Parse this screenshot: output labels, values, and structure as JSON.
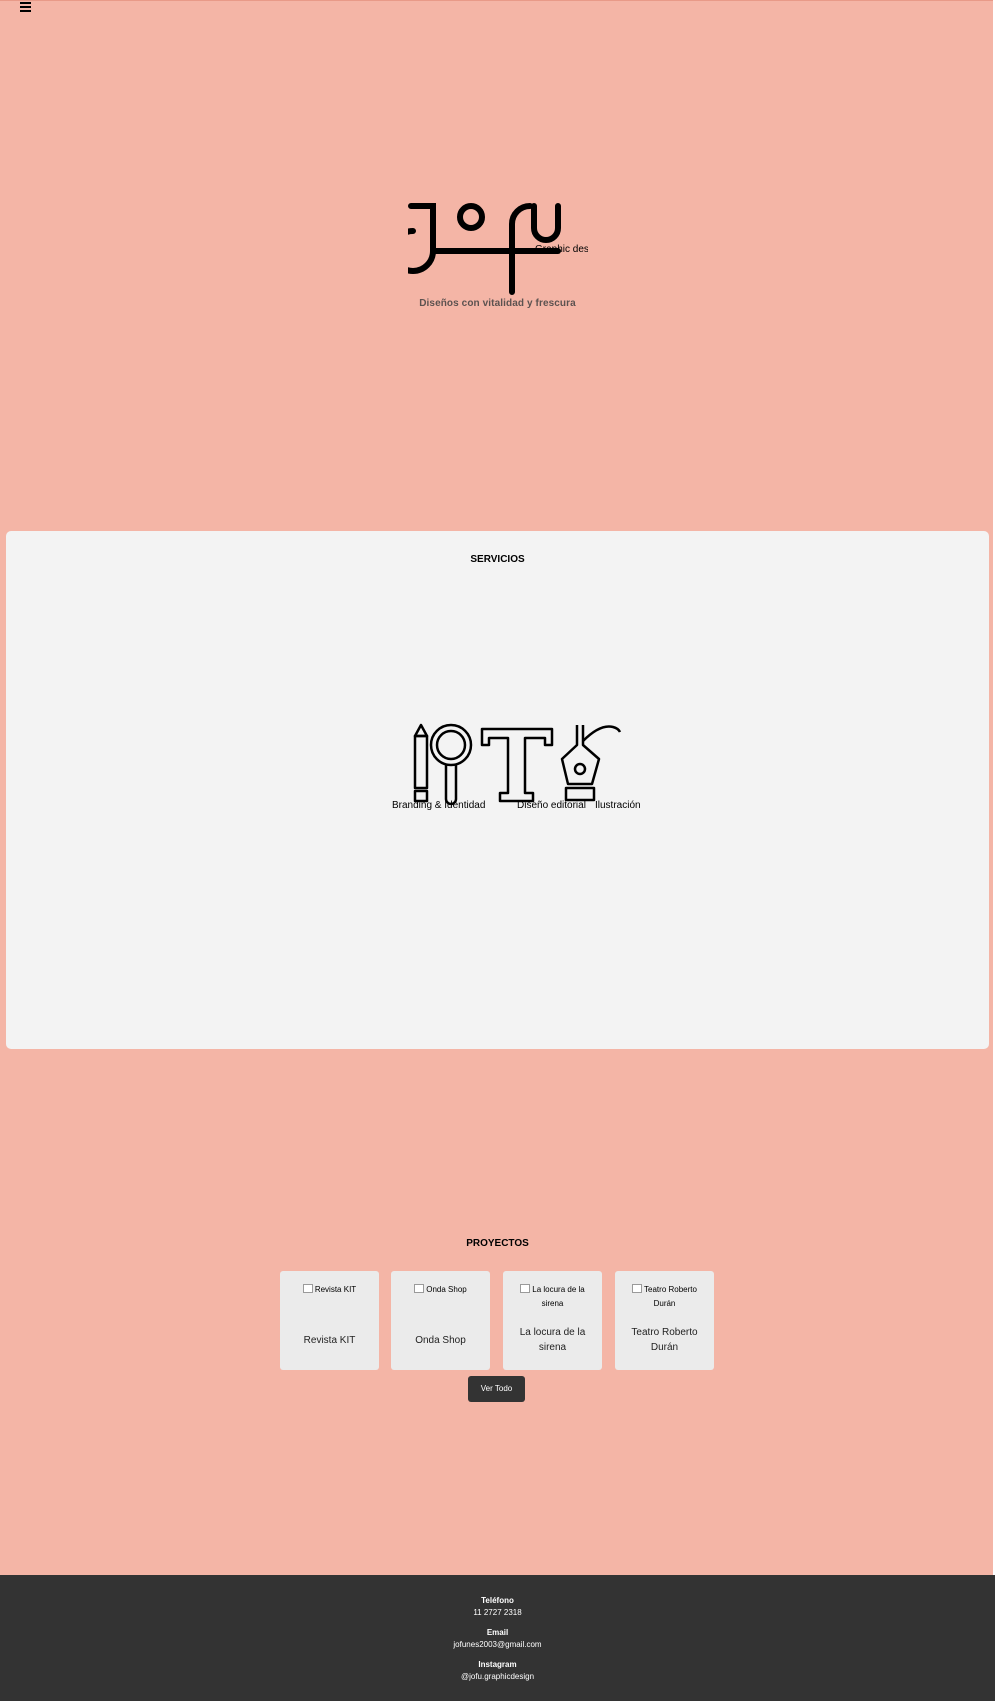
{
  "nav": {
    "menu_icon": "hamburger-menu-icon"
  },
  "hero": {
    "logo_wordmark": "jofu",
    "logo_subtitle": "Graphic design",
    "tagline": "Diseños con vitalidad y frescura"
  },
  "services": {
    "title": "SERVICIOS",
    "items": [
      {
        "label": "Branding & Identidad",
        "icon": "pencil-magnifier-icon"
      },
      {
        "label": "Diseño editorial",
        "icon": "letter-t-icon"
      },
      {
        "label": "Ilustración",
        "icon": "pen-nib-icon"
      }
    ]
  },
  "projects": {
    "title": "PROYECTOS",
    "items": [
      {
        "image_alt": "Revista KIT",
        "name": "Revista KIT"
      },
      {
        "image_alt": "Onda Shop",
        "name": "Onda Shop"
      },
      {
        "image_alt": "La locura de la sirena",
        "name": "La locura de la sirena"
      },
      {
        "image_alt": "Teatro Roberto Durán",
        "name": "Teatro Roberto Durán"
      }
    ],
    "view_all_label": "Ver Todo"
  },
  "footer": {
    "phone_label": "Teléfono",
    "phone": "11 2727 2318",
    "email_label": "Email",
    "email": "jofunes2003@gmail.com",
    "instagram_label": "Instagram",
    "instagram": "@jofu.graphicdesign"
  },
  "colors": {
    "background": "#f4b5a6",
    "panel": "#f3f3f3",
    "card": "#ebebeb",
    "dark": "#333333"
  }
}
